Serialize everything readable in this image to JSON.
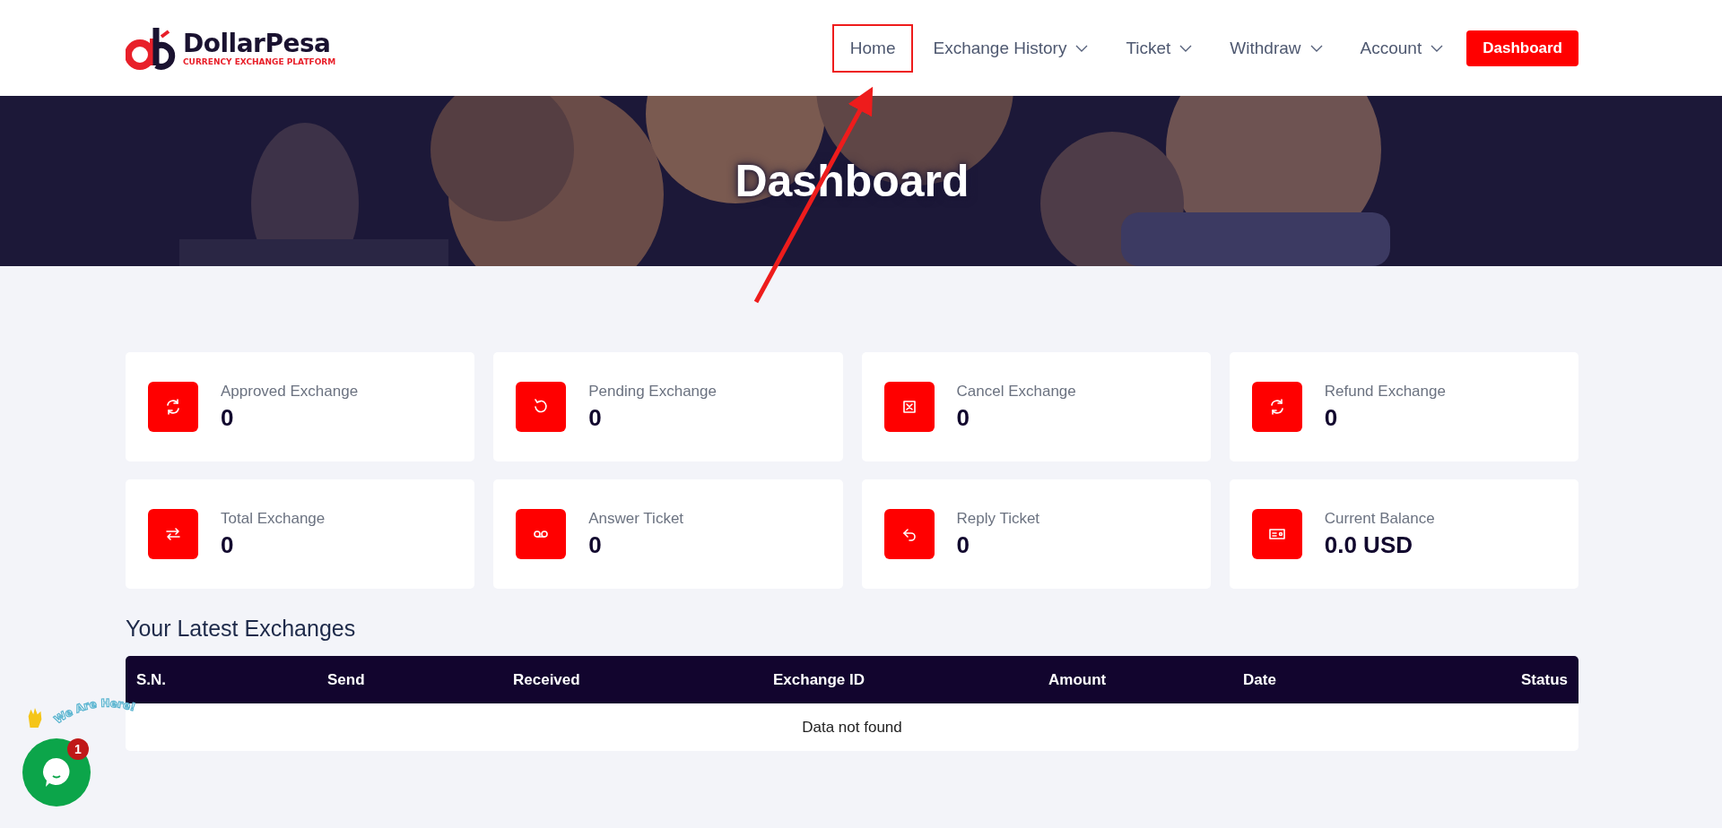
{
  "logo": {
    "name": "DollarPesa",
    "tagline": "CURRENCY EXCHANGE PLATFORM"
  },
  "nav": [
    {
      "label": "Home",
      "dropdown": false,
      "highlighted": true
    },
    {
      "label": "Exchange History",
      "dropdown": true,
      "highlighted": false
    },
    {
      "label": "Ticket",
      "dropdown": true,
      "highlighted": false
    },
    {
      "label": "Withdraw",
      "dropdown": true,
      "highlighted": false
    },
    {
      "label": "Account",
      "dropdown": true,
      "highlighted": false
    }
  ],
  "header_button": "Dashboard",
  "banner": {
    "title": "Dashboard",
    "kind": "picture"
  },
  "stats": [
    {
      "label": "Approved Exchange",
      "value": "0"
    },
    {
      "label": "Pending Exchange",
      "value": "0"
    },
    {
      "label": "Cancel Exchange",
      "value": "0"
    },
    {
      "label": "Refund Exchange",
      "value": "0"
    },
    {
      "label": "Total Exchange",
      "value": "0"
    },
    {
      "label": "Answer Ticket",
      "value": "0"
    },
    {
      "label": "Reply Ticket",
      "value": "0"
    },
    {
      "label": "Current Balance",
      "value": "0.0 USD"
    }
  ],
  "latest": {
    "title": "Your Latest Exchanges",
    "columns": [
      "S.N.",
      "Send",
      "Received",
      "Exchange ID",
      "Amount",
      "Date",
      "Status"
    ],
    "empty_message": "Data not found"
  },
  "chat": {
    "caption": "We Are Here!",
    "badge": "1"
  }
}
